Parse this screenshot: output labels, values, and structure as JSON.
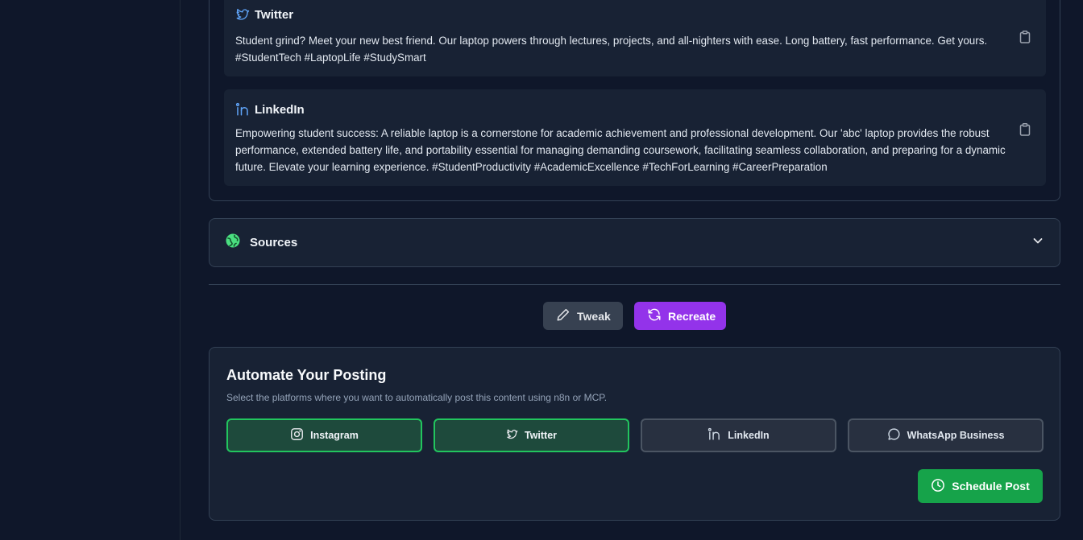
{
  "posts": {
    "twitter": {
      "platform": "Twitter",
      "text": "Student grind? Meet your new best friend. Our laptop powers through lectures, projects, and all-nighters with ease. Long battery, fast performance. Get yours. #StudentTech #LaptopLife #StudySmart"
    },
    "linkedin": {
      "platform": "LinkedIn",
      "text": "Empowering student success: A reliable laptop is a cornerstone for academic achievement and professional development. Our 'abc' laptop provides the robust performance, extended battery life, and portability essential for managing demanding coursework, facilitating seamless collaboration, and preparing for a dynamic future. Elevate your learning experience. #StudentProductivity #AcademicExcellence #TechForLearning #CareerPreparation"
    }
  },
  "sources": {
    "title": "Sources",
    "expanded": false
  },
  "actions": {
    "tweak": "Tweak",
    "recreate": "Recreate"
  },
  "automate": {
    "title": "Automate Your Posting",
    "description": "Select the platforms where you want to automatically post this content using n8n or MCP.",
    "platforms": [
      {
        "label": "Instagram",
        "selected": true,
        "icon": "instagram-icon"
      },
      {
        "label": "Twitter",
        "selected": true,
        "icon": "bird-icon"
      },
      {
        "label": "LinkedIn",
        "selected": false,
        "icon": "linkedin-icon"
      },
      {
        "label": "WhatsApp Business",
        "selected": false,
        "icon": "chat-bubble-icon"
      }
    ],
    "schedule_label": "Schedule Post"
  },
  "colors": {
    "background": "#0f172a",
    "card": "#182234",
    "accent_purple": "#9333ea",
    "accent_green": "#16a34a",
    "selected_border": "#22c55e",
    "twitter_icon": "#60a5fa",
    "linkedin_icon": "#60a5fa"
  }
}
